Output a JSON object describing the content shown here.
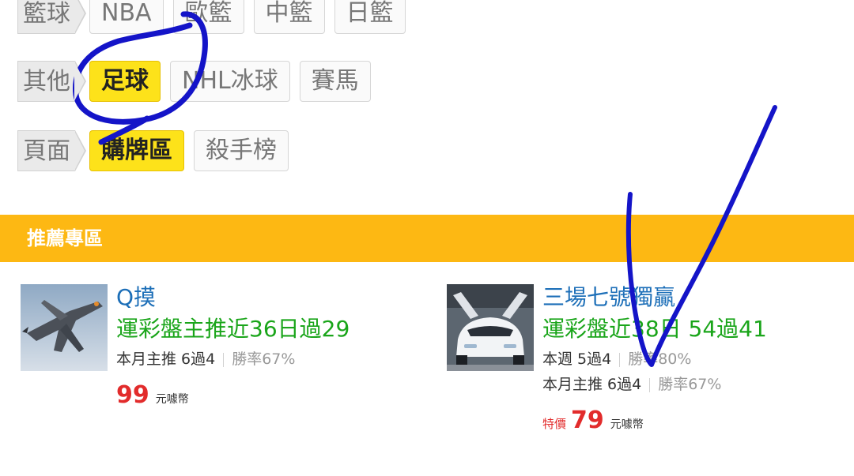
{
  "filters": [
    {
      "label": "籃球",
      "chips": [
        {
          "text": "NBA",
          "active": false
        },
        {
          "text": "歐籃",
          "active": false
        },
        {
          "text": "中籃",
          "active": false
        },
        {
          "text": "日籃",
          "active": false
        }
      ]
    },
    {
      "label": "其他",
      "chips": [
        {
          "text": "足球",
          "active": true
        },
        {
          "text": "NHL冰球",
          "active": false
        },
        {
          "text": "賽馬",
          "active": false
        }
      ]
    },
    {
      "label": "頁面",
      "chips": [
        {
          "text": "購牌區",
          "active": true
        },
        {
          "text": "殺手榜",
          "active": false
        }
      ]
    }
  ],
  "section": {
    "title": "推薦專區"
  },
  "cards": [
    {
      "name": "Q摸",
      "record": "運彩盤主推近36日過29",
      "stats": [
        {
          "label": "本月主推 6過4",
          "rate": "勝率67%"
        }
      ],
      "price": {
        "special": "",
        "amount": "99",
        "unit": "元噱幣"
      }
    },
    {
      "name": "三場七號獨贏",
      "record": "運彩盤近38日 54過41",
      "stats": [
        {
          "label": "本週 5過4",
          "rate": "勝率80%"
        },
        {
          "label": "本月主推 6過4",
          "rate": "勝率67%"
        }
      ],
      "price": {
        "special": "特價",
        "amount": "79",
        "unit": "元噱幣"
      }
    }
  ],
  "colors": {
    "accent": "#fdb813",
    "active_chip": "#fde21a",
    "name_link": "#1d6fb8",
    "record": "#1aa51a",
    "price": "#e22b2b",
    "annotation": "#1414c8"
  }
}
